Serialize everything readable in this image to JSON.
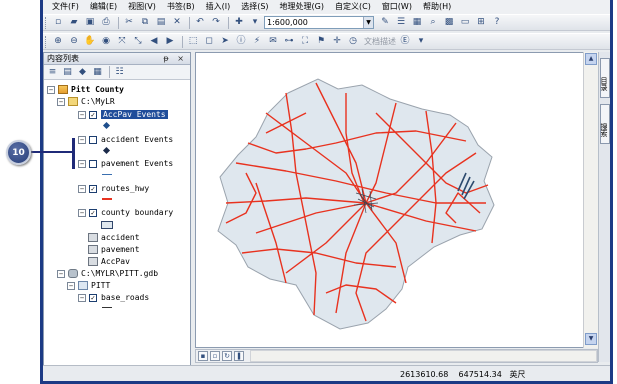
{
  "menu": [
    "文件(F)",
    "编辑(E)",
    "视图(V)",
    "书签(B)",
    "插入(I)",
    "选择(S)",
    "地理处理(G)",
    "自定义(C)",
    "窗口(W)",
    "帮助(H)"
  ],
  "toolbar": {
    "scale": "1:600,000",
    "text_tool": "文档描述",
    "buttons": [
      "new-icon",
      "open-icon",
      "save-icon",
      "print-icon",
      "cut-icon",
      "copy-icon",
      "paste-icon",
      "delete-icon",
      "undo-icon",
      "redo-icon",
      "add-data-icon"
    ]
  },
  "toc": {
    "title": "内容列表",
    "controls": "ᵽ ×",
    "tree": [
      {
        "label": "Pitt County",
        "type": "layers"
      },
      {
        "label": "C:\\MyLR",
        "type": "folder"
      },
      {
        "label": "AccPav Events",
        "type": "layer",
        "checked": true,
        "selected": true
      },
      {
        "label": "accident Events",
        "type": "layer",
        "checked": false
      },
      {
        "label": "pavement Events",
        "type": "layer",
        "checked": false
      },
      {
        "label": "routes_hwy",
        "type": "layer",
        "checked": true
      },
      {
        "label": "county boundary",
        "type": "layer",
        "checked": true
      },
      {
        "label": "accident",
        "type": "table"
      },
      {
        "label": "pavement",
        "type": "table"
      },
      {
        "label": "AccPav",
        "type": "table"
      },
      {
        "label": "C:\\MYLR\\PITT.gdb",
        "type": "geodatabase"
      },
      {
        "label": "PITT",
        "type": "dataset"
      },
      {
        "label": "base_roads",
        "type": "layer",
        "checked": true
      }
    ]
  },
  "dock": {
    "tab1": "目录",
    "tab2": "搜索"
  },
  "status": {
    "x": "2613610.68",
    "y": "647514.34",
    "unit": "英尺"
  },
  "callout": {
    "number": "10"
  },
  "colors": {
    "road": "#e8321f",
    "county_fill": "#dfe7ee",
    "county_edge": "#9aa3ad",
    "selection": "#1f4d9a",
    "callout": "#263d78"
  }
}
